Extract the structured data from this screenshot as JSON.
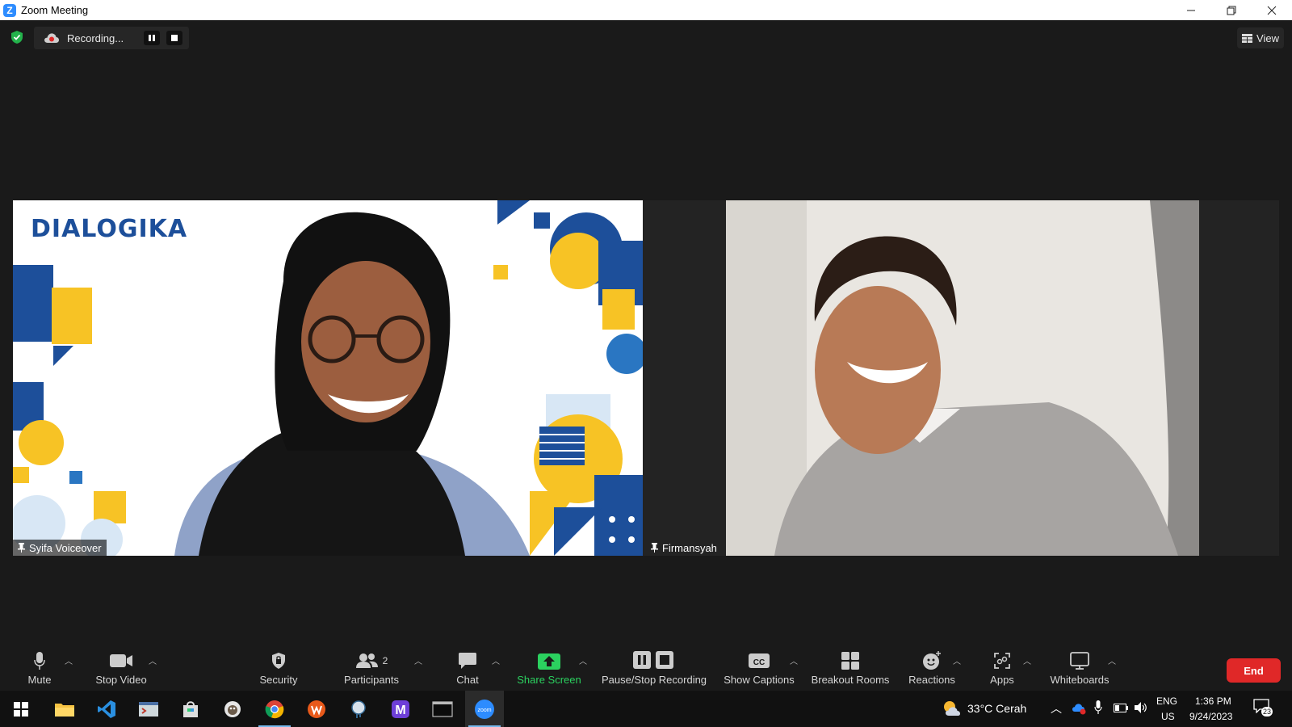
{
  "window": {
    "title": "Zoom Meeting",
    "app_letter": "Z"
  },
  "recording": {
    "status_text": "Recording..."
  },
  "view_button": {
    "label": "View"
  },
  "participants": [
    {
      "name": "Syifa Voiceover",
      "brand_text": "DIALOGIKA"
    },
    {
      "name": "Firmansyah"
    }
  ],
  "toolbar": {
    "mute": "Mute",
    "stop_video": "Stop Video",
    "security": "Security",
    "participants": "Participants",
    "participants_count": "2",
    "chat": "Chat",
    "share_screen": "Share Screen",
    "pause_stop_recording": "Pause/Stop Recording",
    "show_captions": "Show Captions",
    "breakout_rooms": "Breakout Rooms",
    "reactions": "Reactions",
    "apps": "Apps",
    "whiteboards": "Whiteboards",
    "end": "End"
  },
  "taskbar": {
    "weather": "33°C  Cerah",
    "lang_line1": "ENG",
    "lang_line2": "US",
    "time": "1:36 PM",
    "date": "9/24/2023",
    "notification_count": "23"
  },
  "colors": {
    "accent_blue": "#2d8cff",
    "brand_navy": "#1d4f9a",
    "brand_yellow": "#f7c325",
    "share_green": "#2bd15f",
    "end_red": "#e02828"
  }
}
